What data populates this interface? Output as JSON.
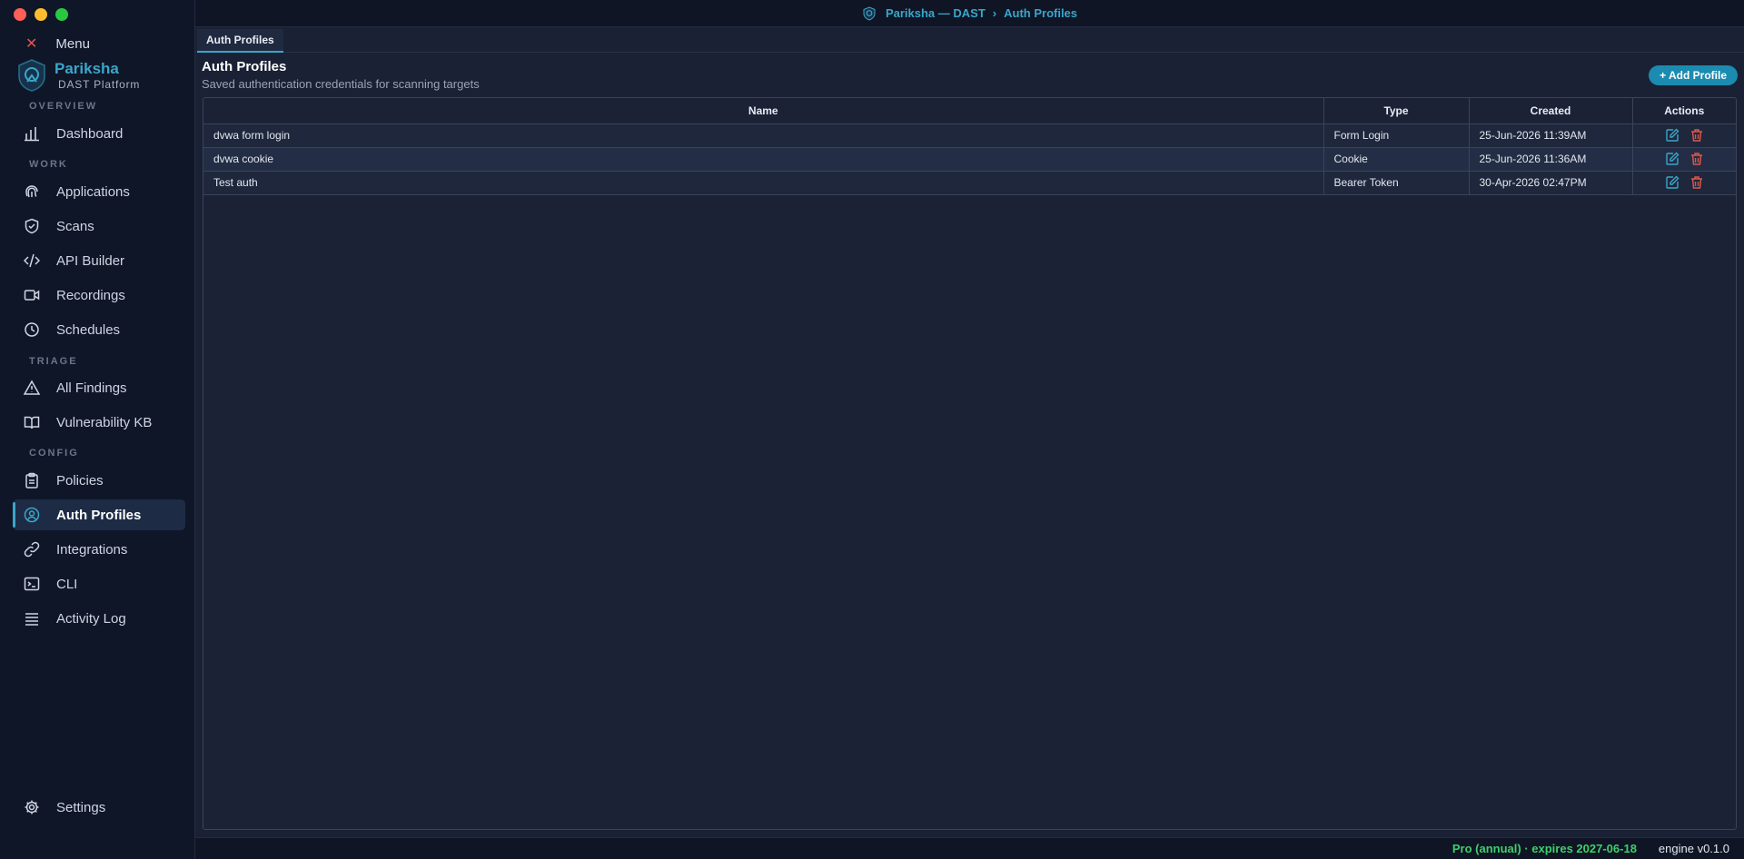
{
  "window": {
    "title_app": "Pariksha — DAST",
    "title_separator": "›",
    "title_page": "Auth Profiles"
  },
  "sidebar": {
    "menu_label": "Menu",
    "brand_name": "Pariksha",
    "brand_sub": "DAST Platform",
    "sections": {
      "overview": "OVERVIEW",
      "work": "WORK",
      "triage": "TRIAGE",
      "config": "CONFIG"
    },
    "items": {
      "dashboard": "Dashboard",
      "applications": "Applications",
      "scans": "Scans",
      "api_builder": "API Builder",
      "recordings": "Recordings",
      "schedules": "Schedules",
      "all_findings": "All Findings",
      "vulnerability_kb": "Vulnerability KB",
      "policies": "Policies",
      "auth_profiles": "Auth Profiles",
      "integrations": "Integrations",
      "cli": "CLI",
      "activity_log": "Activity Log",
      "settings": "Settings"
    },
    "active_item": "Auth Profiles"
  },
  "main": {
    "tab_label": "Auth Profiles",
    "title": "Auth Profiles",
    "subtitle": "Saved authentication credentials for scanning targets",
    "add_button": "+ Add Profile",
    "table": {
      "columns": [
        "Name",
        "Type",
        "Created",
        "Actions"
      ],
      "rows": [
        {
          "name": "dvwa form login",
          "type": "Form Login",
          "created": "25-Jun-2026 11:39AM"
        },
        {
          "name": "dvwa cookie",
          "type": "Cookie",
          "created": "25-Jun-2026 11:36AM"
        },
        {
          "name": "Test auth",
          "type": "Bearer Token",
          "created": "30-Apr-2026 02:47PM"
        }
      ]
    }
  },
  "status": {
    "license": "Pro (annual) · expires 2027-06-18",
    "engine": "engine v0.1.0"
  },
  "colors": {
    "accent": "#3aa6c9",
    "button": "#1b8bb0",
    "license_green": "#3fcf6b",
    "delete_red": "#e0564b"
  },
  "icons": {
    "edit": "edit-icon",
    "delete": "trash-icon"
  }
}
